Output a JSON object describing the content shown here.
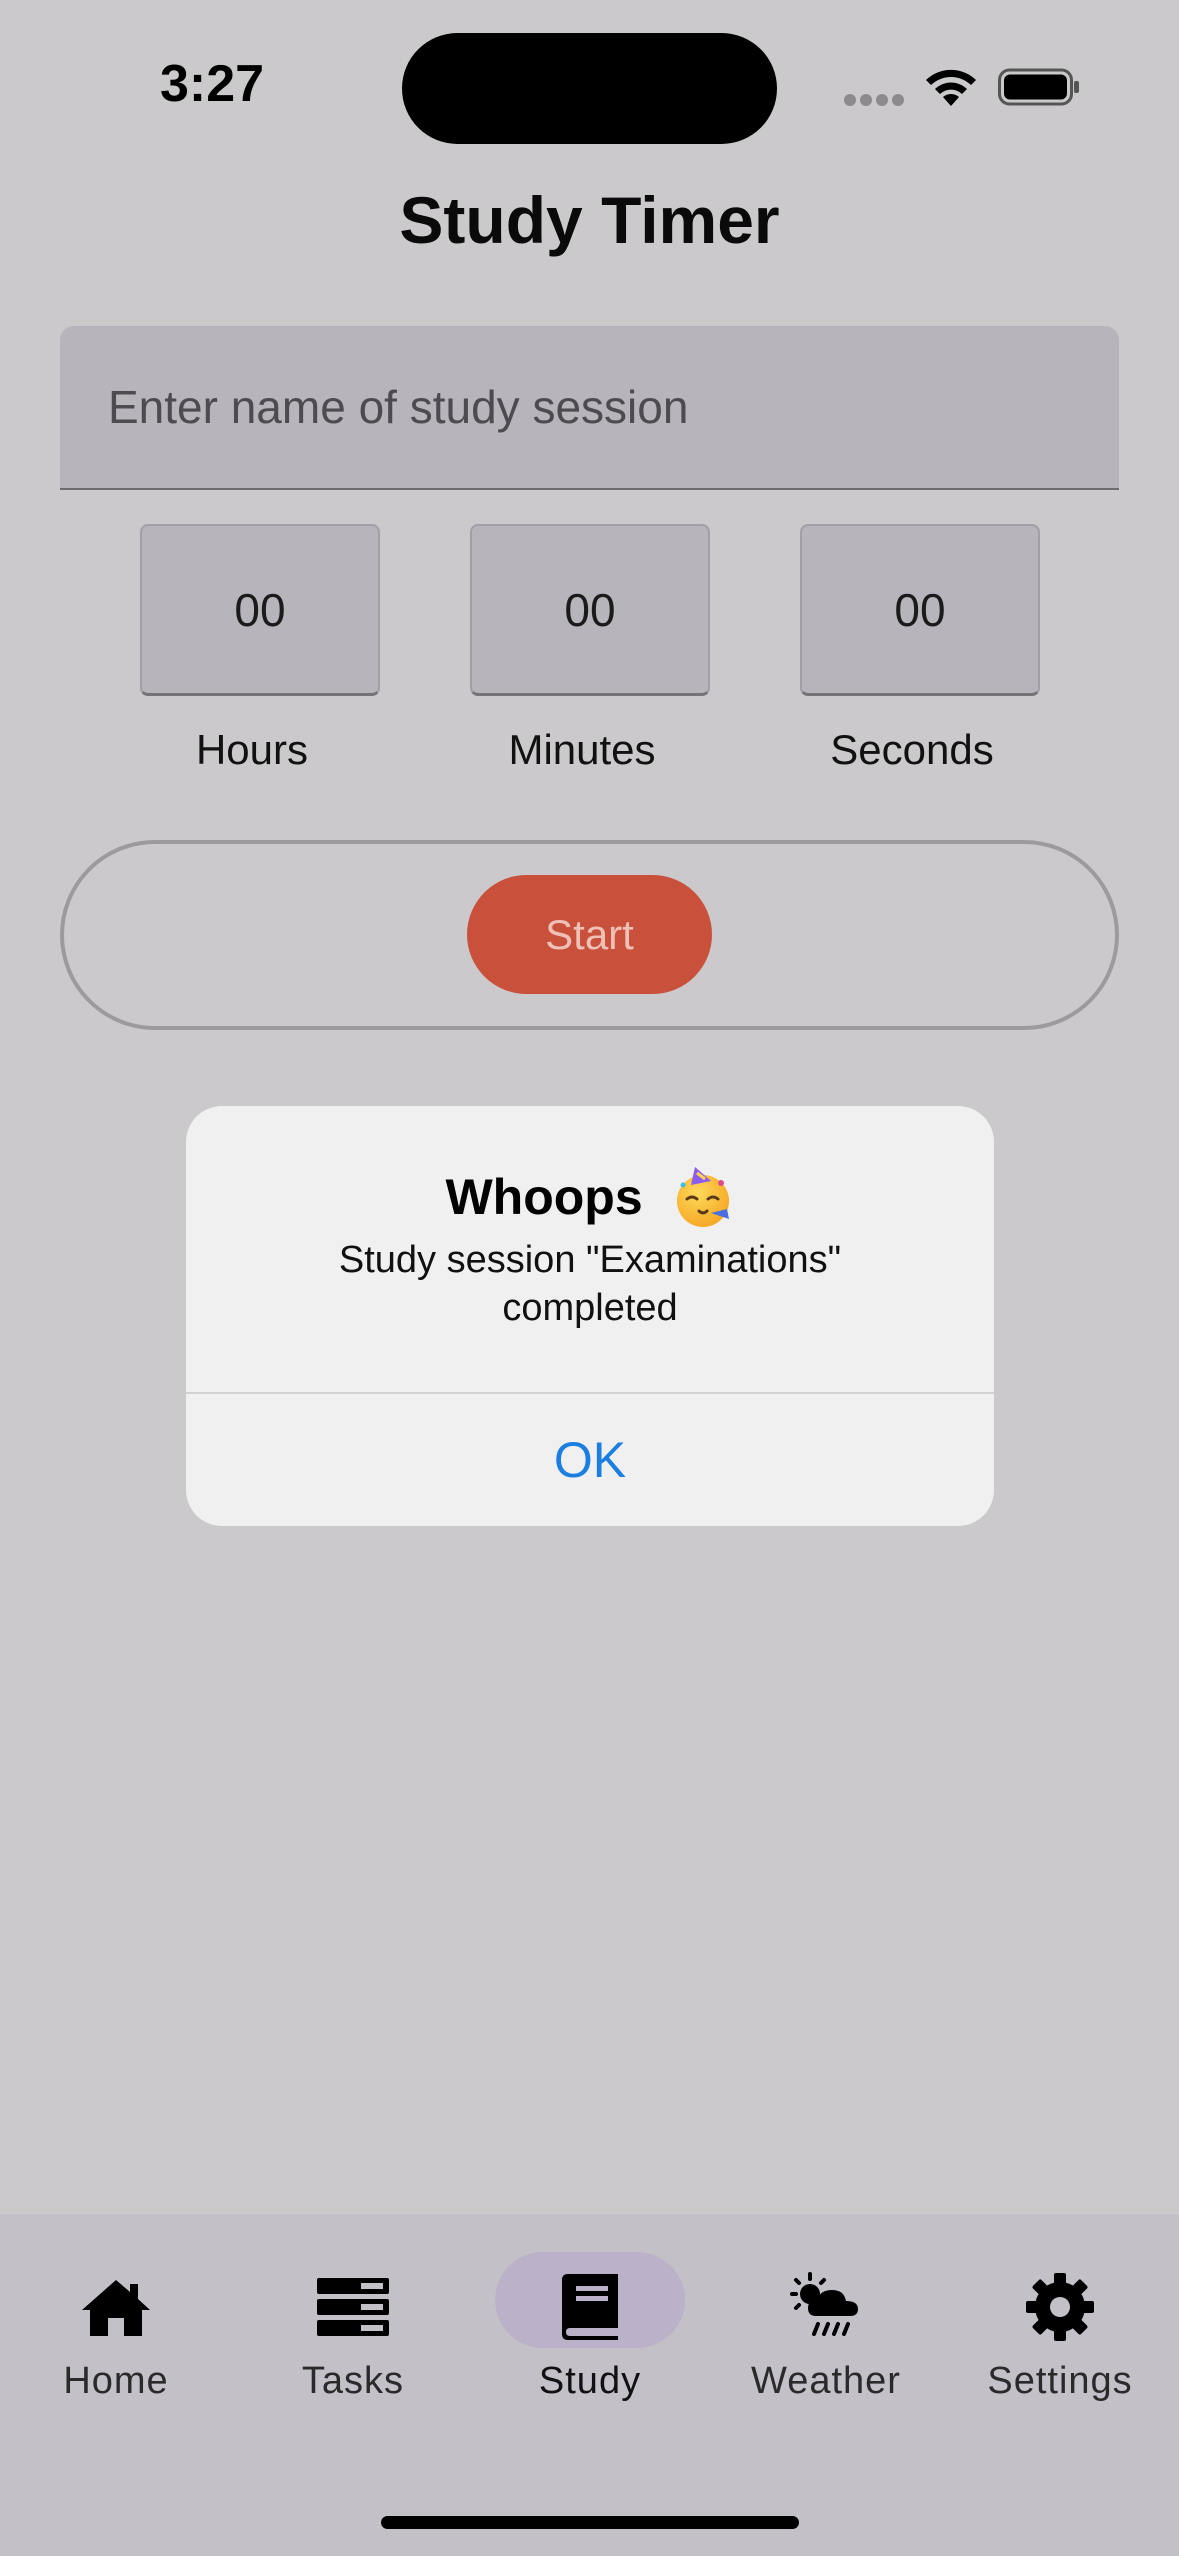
{
  "status_bar": {
    "time": "3:27"
  },
  "header": {
    "title": "Study Timer"
  },
  "session": {
    "value": "",
    "placeholder": "Enter name of study session"
  },
  "timer": {
    "hours": {
      "value": "00",
      "label": "Hours"
    },
    "minutes": {
      "value": "00",
      "label": "Minutes"
    },
    "seconds": {
      "value": "00",
      "label": "Seconds"
    }
  },
  "start_button": {
    "label": "Start",
    "color": "#c9503b"
  },
  "alert": {
    "title": "Whoops",
    "title_icon": "partying-face-emoji",
    "message": "Study session \"Examinations\" completed",
    "ok_label": "OK",
    "ok_color": "#1a7fe0"
  },
  "bottom_nav": {
    "active": "Study",
    "items": [
      {
        "label": "Home",
        "icon": "home-icon"
      },
      {
        "label": "Tasks",
        "icon": "tasks-icon"
      },
      {
        "label": "Study",
        "icon": "book-icon"
      },
      {
        "label": "Weather",
        "icon": "weather-icon"
      },
      {
        "label": "Settings",
        "icon": "gear-icon"
      }
    ]
  }
}
